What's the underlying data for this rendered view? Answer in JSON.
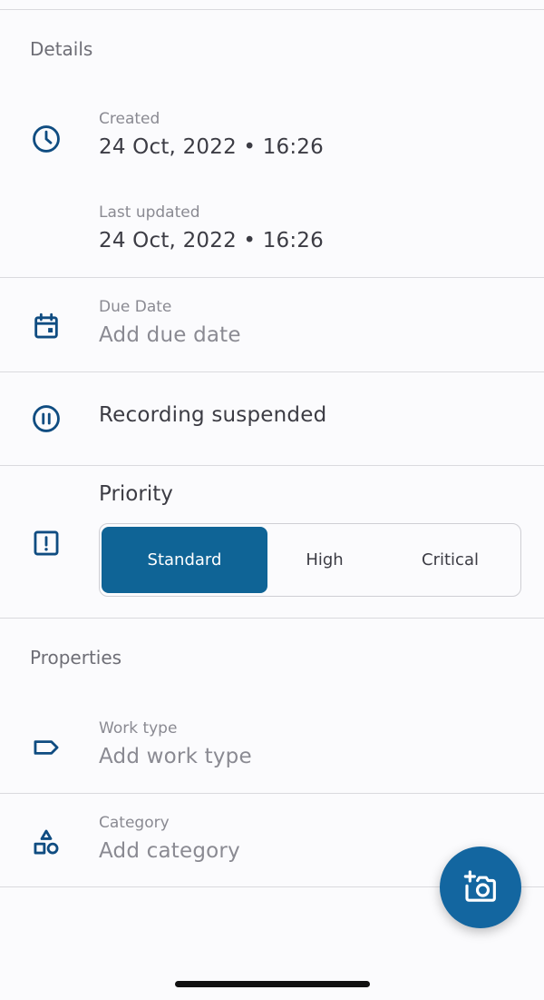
{
  "details": {
    "title": "Details",
    "created": {
      "label": "Created",
      "value": "24 Oct, 2022 • 16:26",
      "icon": "clock-icon"
    },
    "last_updated": {
      "label": "Last updated",
      "value": "24 Oct, 2022 • 16:26"
    },
    "due_date": {
      "label": "Due Date",
      "placeholder": "Add due date",
      "icon": "calendar-icon"
    },
    "recording": {
      "text": "Recording suspended",
      "icon": "pause-circle-icon"
    },
    "priority": {
      "title": "Priority",
      "icon": "exclamation-square-icon",
      "options": [
        "Standard",
        "High",
        "Critical"
      ],
      "selected": "Standard"
    }
  },
  "properties": {
    "title": "Properties",
    "work_type": {
      "label": "Work type",
      "placeholder": "Add work type",
      "icon": "tag-icon"
    },
    "category": {
      "label": "Category",
      "placeholder": "Add category",
      "icon": "shapes-icon"
    }
  },
  "fab": {
    "icon": "add-photo-icon"
  },
  "colors": {
    "accent": "#1366a0",
    "selected_segment": "#0f6496",
    "icon": "#0f4c81",
    "divider": "#dadade",
    "background": "#fbfbfd"
  }
}
